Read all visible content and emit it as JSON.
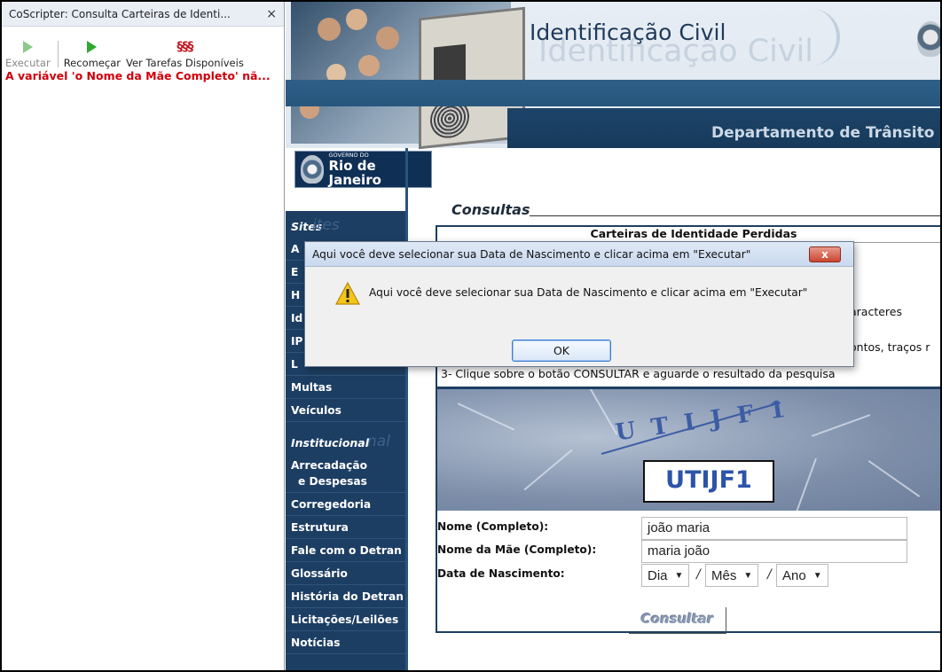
{
  "coscripter": {
    "title": "CoScripter: Consulta Carteiras de Identi...",
    "close": "×",
    "run_label": "Executar",
    "restart_label": "Recomeçar",
    "tasks_label": "Ver Tarefas Disponíveis",
    "tasks_icon": "§§§",
    "error": "A variável 'o Nome da Mãe Completo' nã..."
  },
  "banner": {
    "title": "Identificação Civil",
    "ghost_title": "Identificação Civil",
    "department": "Departamento de Trânsito do"
  },
  "gov_logo": {
    "small_line1": "GOVERNO DO",
    "big": "Rio de Janeiro"
  },
  "nav": {
    "sites_heading": "Sites",
    "sites_ghost": "ites",
    "sites_items": [
      "A",
      "E",
      "H",
      "Id",
      "IP",
      "L",
      "Multas",
      "Veículos"
    ],
    "inst_heading": "Institucional",
    "inst_ghost": "nal",
    "inst_items": [
      "Arrecadação",
      "e Despesas",
      "Corregedoria",
      "Estrutura",
      "Fale com o Detran",
      "Glossário",
      "História do Detran",
      "Licitações/Leilões",
      "Notícias"
    ]
  },
  "content": {
    "consultas_title": "Consultas",
    "box_title": "Carteiras de Identidade Perdidas",
    "instr_1": "aracteres",
    "instr_2": "ontos, traços r",
    "instr_3": "3- Clique sobre o botão CONSULTAR e aguarde o resultado da pesquisa",
    "captcha_distorted": "UTIJF1",
    "captcha_clear": "UTIJF1",
    "name_label": "Nome (Completo):",
    "name_value": "joão maria",
    "mother_label": "Nome da Mãe (Completo):",
    "mother_value": "maria joão",
    "dob_label": "Data de Nascimento:",
    "dob_day": "Dia",
    "dob_month": "Mês",
    "dob_year": "Ano",
    "dob_sep": "/",
    "consultar": "Consultar"
  },
  "dialog": {
    "title": "Aqui você deve selecionar sua Data de Nascimento e clicar acima em \"Executar\"",
    "message": "Aqui você deve selecionar sua Data de Nascimento e clicar acima em \"Executar\"",
    "ok": "OK",
    "close": "x"
  }
}
